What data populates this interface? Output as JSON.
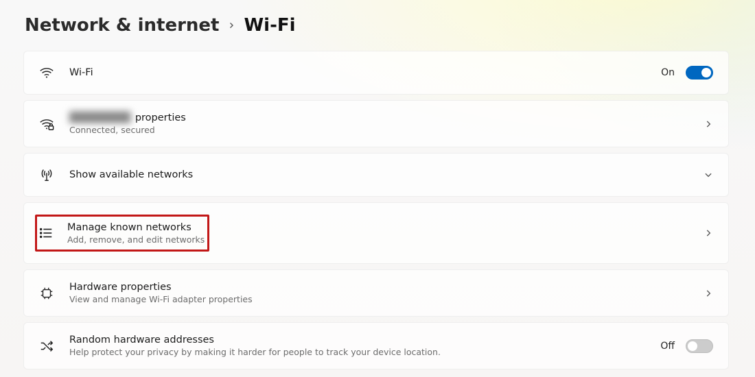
{
  "breadcrumb": {
    "parent": "Network & internet",
    "current": "Wi-Fi"
  },
  "rows": {
    "wifi": {
      "label": "Wi-Fi",
      "state_label": "On",
      "on": true
    },
    "network_properties": {
      "name_prefix": "████████",
      "name_suffix": "properties",
      "sub": "Connected, secured"
    },
    "available": {
      "label": "Show available networks"
    },
    "manage": {
      "label": "Manage known networks",
      "sub": "Add, remove, and edit networks"
    },
    "hardware": {
      "label": "Hardware properties",
      "sub": "View and manage Wi-Fi adapter properties"
    },
    "random": {
      "label": "Random hardware addresses",
      "sub": "Help protect your privacy by making it harder for people to track your device location.",
      "state_label": "Off",
      "on": false
    }
  }
}
